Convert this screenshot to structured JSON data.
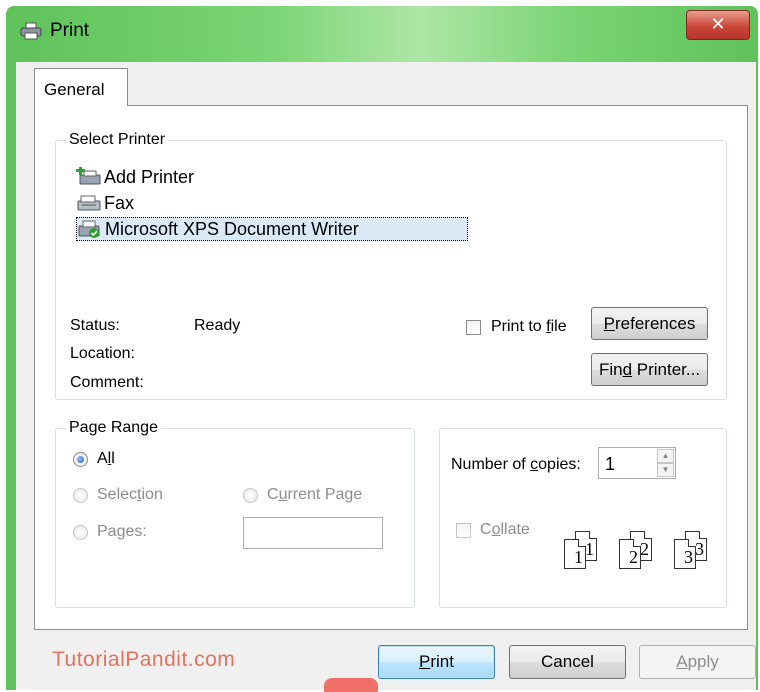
{
  "window": {
    "title": "Print",
    "close_glyph": "✕"
  },
  "tabs": [
    {
      "label": "General"
    }
  ],
  "select_printer": {
    "legend": "Select Printer",
    "printers": [
      {
        "name": "Add Printer",
        "icon": "add-printer-icon"
      },
      {
        "name": "Fax",
        "icon": "fax-icon"
      },
      {
        "name": "Microsoft XPS Document Writer",
        "icon": "xps-printer-icon",
        "selected": true
      }
    ],
    "status_label": "Status:",
    "status_value": "Ready",
    "location_label": "Location:",
    "comment_label": "Comment:",
    "print_to_file": {
      "label_pre": "Print to ",
      "label_accel": "f",
      "label_post": "ile",
      "checked": false
    },
    "preferences_pre": "",
    "preferences_accel": "P",
    "preferences_post": "references",
    "find_pre": "Fin",
    "find_accel": "d",
    "find_post": " Printer..."
  },
  "page_range": {
    "legend": "Page Range",
    "all_pre": "A",
    "all_accel": "l",
    "all_post": "l",
    "selection_pre": "Selec",
    "selection_accel": "t",
    "selection_post": "ion",
    "current_pre": "C",
    "current_accel": "u",
    "current_post": "rrent Page",
    "pages_pre": "Pa",
    "pages_accel": "g",
    "pages_post": "es:",
    "pages_value": ""
  },
  "copies": {
    "label_pre": "Number of ",
    "label_accel": "c",
    "label_post": "opies:",
    "value": "1",
    "collate_pre": "C",
    "collate_accel": "o",
    "collate_post": "llate",
    "collate_checked": false
  },
  "collate_pages": [
    [
      "1",
      "1"
    ],
    [
      "2",
      "2"
    ],
    [
      "3",
      "3"
    ]
  ],
  "buttons": {
    "print_pre": "",
    "print_accel": "P",
    "print_post": "rint",
    "cancel": "Cancel",
    "apply_pre": "",
    "apply_accel": "A",
    "apply_post": "pply"
  },
  "watermark": "TutorialPandit.com",
  "colors": {
    "title_bar": "#7bd475",
    "close_button": "#c9483a",
    "watermark": "#e2735d",
    "selection": "#dceaf7"
  }
}
